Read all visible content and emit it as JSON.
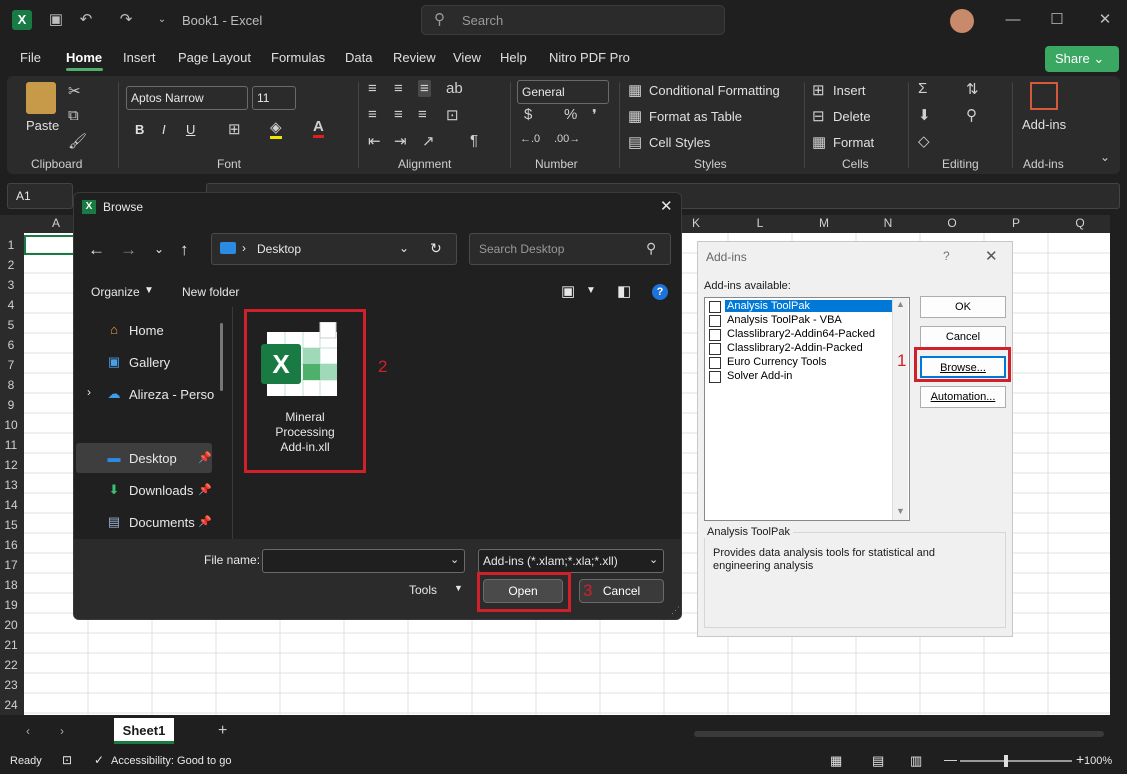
{
  "app": {
    "title": "Book1  -  Excel",
    "search_placeholder": "Search",
    "share_label": "Share"
  },
  "menu": [
    "File",
    "Home",
    "Insert",
    "Page Layout",
    "Formulas",
    "Data",
    "Review",
    "View",
    "Help",
    "Nitro PDF Pro"
  ],
  "ribbon": {
    "paste": "Paste",
    "clipboard": "Clipboard",
    "font_name": "Aptos Narrow",
    "font_size": "11",
    "bold": "B",
    "italic": "I",
    "underline": "U",
    "font": "Font",
    "alignment": "Alignment",
    "number_format": "General",
    "number": "Number",
    "conditional_formatting": "Conditional Formatting",
    "format_as_table": "Format as Table",
    "cell_styles": "Cell Styles",
    "styles": "Styles",
    "insert": "Insert",
    "delete": "Delete",
    "format": "Format",
    "cells": "Cells",
    "editing": "Editing",
    "addins_btn": "Add-ins",
    "addins_group": "Add-ins"
  },
  "namebox": "A1",
  "columns": [
    "A",
    "K",
    "L",
    "M",
    "N",
    "O",
    "P",
    "Q"
  ],
  "rows": [
    "1",
    "2",
    "3",
    "4",
    "5",
    "6",
    "7",
    "8",
    "9",
    "10",
    "11",
    "12",
    "13",
    "14",
    "15",
    "16",
    "17",
    "18",
    "19",
    "20",
    "21",
    "22",
    "23",
    "24"
  ],
  "sheet_tab": "Sheet1",
  "status": {
    "ready": "Ready",
    "accessibility": "Accessibility: Good to go",
    "zoom": "100%"
  },
  "browse": {
    "title": "Browse",
    "path": "Desktop",
    "search_placeholder": "Search Desktop",
    "organize": "Organize",
    "new_folder": "New folder",
    "nav": [
      "Home",
      "Gallery",
      "Alireza - Persona",
      "Desktop",
      "Downloads",
      "Documents"
    ],
    "file_name_lines": [
      "Mineral",
      "Processing",
      "Add-in.xll"
    ],
    "file_name_label": "File name:",
    "file_name_value": "",
    "filter": "Add-ins (*.xlam;*.xla;*.xll)",
    "tools": "Tools",
    "open": "Open",
    "cancel": "Cancel"
  },
  "addins": {
    "title": "Add-ins",
    "help": "?",
    "available_label": "Add-ins available:",
    "items": [
      "Analysis ToolPak",
      "Analysis ToolPak - VBA",
      "Classlibrary2-Addin64-Packed",
      "Classlibrary2-Addin-Packed",
      "Euro Currency Tools",
      "Solver Add-in"
    ],
    "ok": "OK",
    "cancel": "Cancel",
    "browse": "Browse...",
    "automation": "Automation...",
    "desc_title": "Analysis ToolPak",
    "desc_text": "Provides data analysis tools for statistical and engineering analysis"
  },
  "annotations": {
    "step1": "1",
    "step2": "2",
    "step3": "3"
  },
  "colors": {
    "accent": "#4fb06b",
    "excel_green": "#1a7a43",
    "highlight_red": "#d0202a",
    "selection_blue": "#0078d7"
  }
}
